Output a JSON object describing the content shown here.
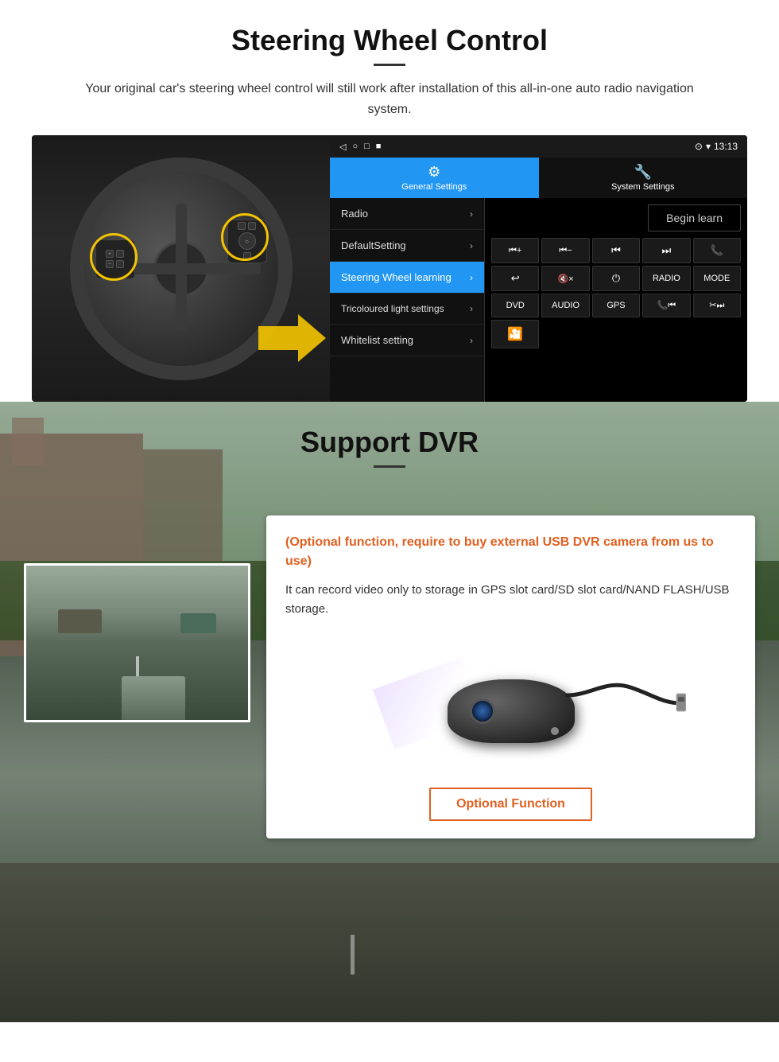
{
  "steering": {
    "title": "Steering Wheel Control",
    "subtitle": "Your original car's steering wheel control will still work after installation of this all-in-one auto radio navigation system.",
    "statusbar": {
      "time": "13:13",
      "icons": "▷ ○ □ ■"
    },
    "tabs": [
      {
        "id": "general",
        "label": "General Settings",
        "active": true
      },
      {
        "id": "system",
        "label": "System Settings",
        "active": false
      }
    ],
    "menu_items": [
      {
        "label": "Radio",
        "active": false
      },
      {
        "label": "DefaultSetting",
        "active": false
      },
      {
        "label": "Steering Wheel learning",
        "active": true
      },
      {
        "label": "Tricoloured light settings",
        "active": false
      },
      {
        "label": "Whitelist setting",
        "active": false
      }
    ],
    "begin_learn": "Begin learn",
    "control_buttons": [
      "⏮+",
      "⏮−",
      "⏮⏮",
      "⏭⏭",
      "📞",
      "↩",
      "🔇×",
      "⏻",
      "RADIO",
      "MODE",
      "DVD",
      "AUDIO",
      "GPS",
      "📞⏮",
      "✂⏭",
      "📷"
    ]
  },
  "dvr": {
    "title": "Support DVR",
    "optional_text": "(Optional function, require to buy external USB DVR camera from us to use)",
    "description": "It can record video only to storage in GPS slot card/SD slot card/NAND FLASH/USB storage.",
    "optional_function_btn": "Optional Function"
  }
}
